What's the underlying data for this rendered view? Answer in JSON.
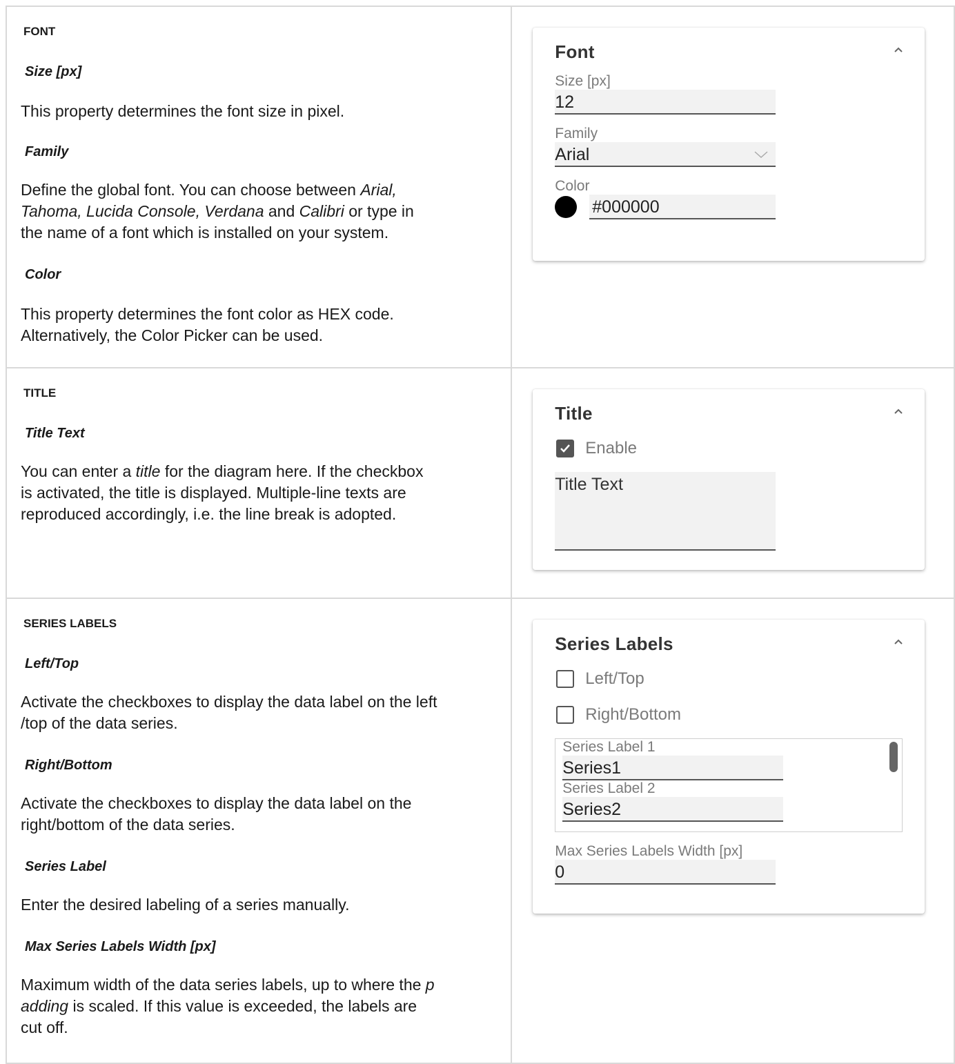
{
  "font_section": {
    "heading": "FONT",
    "size_title": "Size [px]",
    "size_desc": "This property determines the font size in pixel.",
    "family_title": "Family",
    "family_desc_1": "Define the global font. You can choose between ",
    "family_desc_fonts_1": "Arial,",
    "family_desc_fonts_2": "Tahoma, Lucida Console, Verdana",
    "family_desc_and": " and ",
    "family_desc_calibri": "Calibri",
    "family_desc_2": " or type in",
    "family_desc_3": "the name of a font which is installed on your system.",
    "color_title": "Color",
    "color_desc_1": "This property determines the font color as HEX code.",
    "color_desc_2": "Alternatively, the Color Picker can be used.",
    "panel": {
      "title": "Font",
      "size_label": "Size [px]",
      "size_value": "12",
      "family_label": "Family",
      "family_value": "Arial",
      "color_label": "Color",
      "color_value": "#000000",
      "color_swatch": "#000000"
    }
  },
  "title_section": {
    "heading": "TITLE",
    "text_title": "Title Text",
    "desc_1a": "You can enter a ",
    "desc_1b": "title",
    "desc_1c": " for the diagram here. If the checkbox",
    "desc_2": "is activated, the title is displayed. Multiple-line texts are",
    "desc_3": "reproduced accordingly, i.e. the line break is adopted.",
    "panel": {
      "title": "Title",
      "enable_label": "Enable",
      "enable_checked": true,
      "text_value": "Title Text"
    }
  },
  "series_section": {
    "heading": "SERIES LABELS",
    "lefttop_title": "Left/Top",
    "lefttop_desc_1": "Activate the checkboxes to display the data label on the left",
    "lefttop_desc_2": "/top of the data series.",
    "rightbottom_title": "Right/Bottom",
    "rightbottom_desc_1": "Activate the checkboxes to display the data label on the",
    "rightbottom_desc_2": "right/bottom of the data series.",
    "serieslabel_title": "Series Label",
    "serieslabel_desc": "Enter the desired labeling of a series manually.",
    "maxwidth_title": "Max Series Labels Width [px]",
    "maxwidth_desc_1a": "Maximum width of the data series labels, up to where the ",
    "maxwidth_desc_1b": "p",
    "maxwidth_desc_2a": "adding",
    "maxwidth_desc_2b": " is scaled. If this value is exceeded, the labels are",
    "maxwidth_desc_3": "cut off.",
    "panel": {
      "title": "Series Labels",
      "lefttop_label": "Left/Top",
      "rightbottom_label": "Right/Bottom",
      "series": [
        {
          "label": "Series Label 1",
          "value": "Series1"
        },
        {
          "label": "Series Label 2",
          "value": "Series2"
        }
      ],
      "maxwidth_label": "Max Series Labels Width [px]",
      "maxwidth_value": "0"
    }
  }
}
